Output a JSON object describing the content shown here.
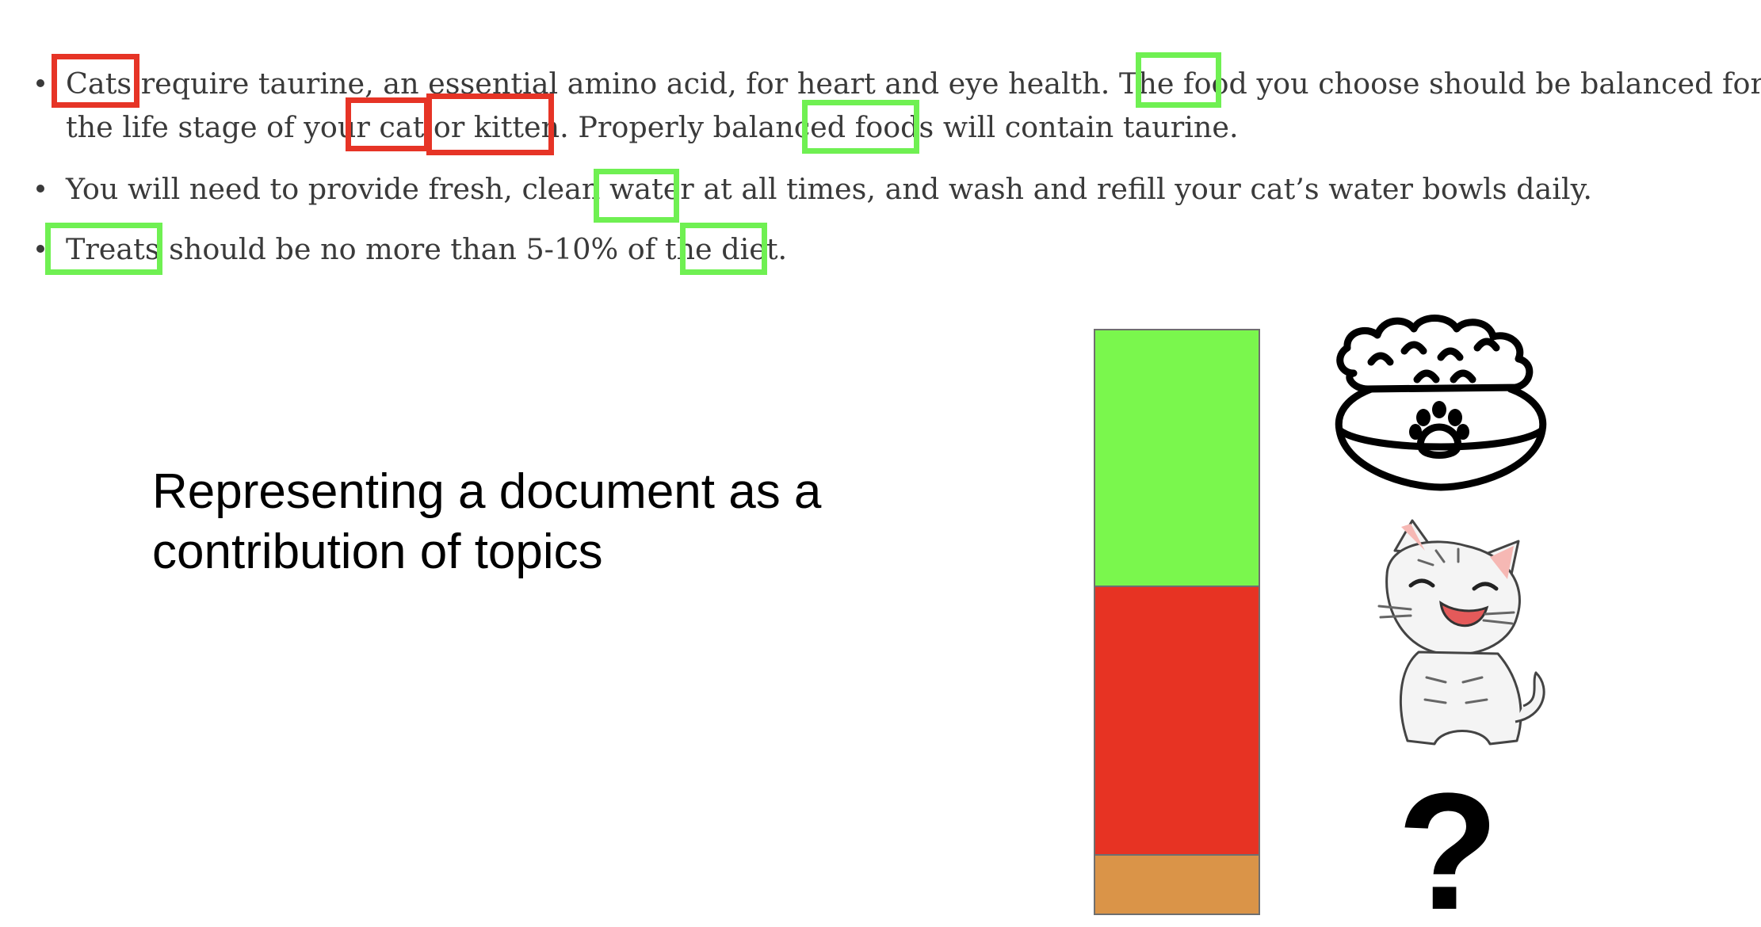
{
  "document": {
    "lines": [
      {
        "text": "Cats require taurine, an essential amino acid, for heart and eye health. The food you choose should be balanced for"
      },
      {
        "text": "the life stage of your cat or kitten. Properly balanced foods will contain taurine."
      },
      {
        "text": "You will need to provide fresh, clean water at all times, and wash and refill your cat’s water bowls daily."
      },
      {
        "text": "Treats should be no more than 5-10% of the diet."
      }
    ],
    "highlights": [
      {
        "word": "Cats",
        "topic": "cat",
        "color": "#e63426"
      },
      {
        "word": "food",
        "topic": "food",
        "color": "#6ff052"
      },
      {
        "word": "cat",
        "topic": "cat",
        "color": "#e63426"
      },
      {
        "word": "kitten.",
        "topic": "cat",
        "color": "#e63426"
      },
      {
        "word": "foods",
        "topic": "food",
        "color": "#6ff052"
      },
      {
        "word": "water",
        "topic": "food",
        "color": "#6ff052"
      },
      {
        "word": "Treats",
        "topic": "food",
        "color": "#6ff052"
      },
      {
        "word": "diet.",
        "topic": "food",
        "color": "#6ff052"
      }
    ]
  },
  "caption": {
    "line1": "Representing a document as a",
    "line2": "contribution of topics"
  },
  "topic_stack": {
    "segments": [
      {
        "topic": "food",
        "color": "#7af74d",
        "share": 0.44,
        "icon": "food-bowl-icon"
      },
      {
        "topic": "cat",
        "color": "#e73323",
        "share": 0.46,
        "icon": "kitten-icon"
      },
      {
        "topic": "unknown",
        "color": "#da9448",
        "share": 0.1,
        "icon": "question-mark-icon"
      }
    ],
    "unknown_symbol": "?"
  }
}
